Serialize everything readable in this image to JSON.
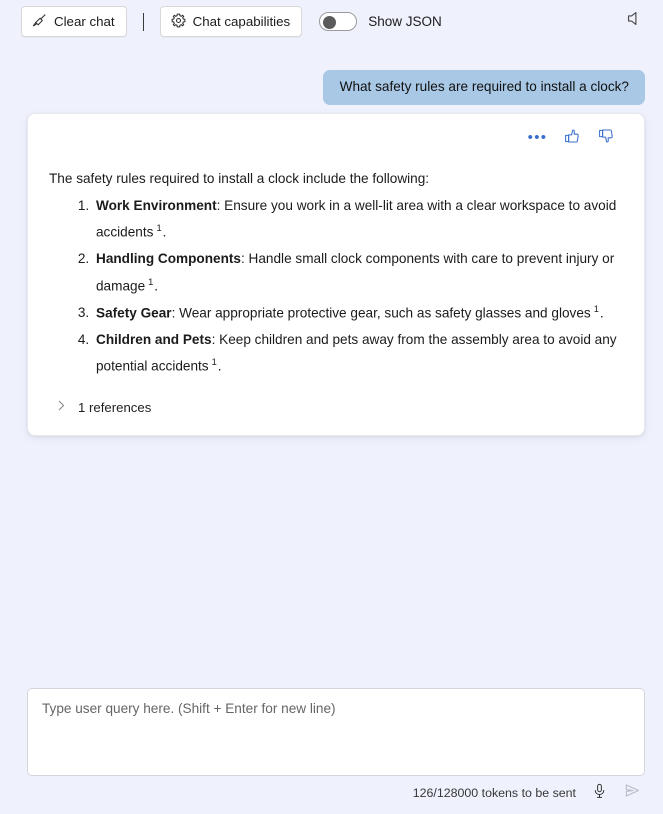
{
  "toolbar": {
    "clear_chat_label": "Clear chat",
    "clear_chat_icon": "broom-icon",
    "chat_capabilities_label": "Chat capabilities",
    "chat_capabilities_icon": "gear-icon",
    "show_json_label": "Show JSON",
    "show_json_state": "off",
    "speaker_icon": "speaker-icon"
  },
  "conversation": {
    "user_message": "What safety rules are required to install a clock?",
    "assistant": {
      "actions": {
        "more_icon": "ellipsis-icon",
        "thumbs_up_icon": "thumbs-up-icon",
        "thumbs_down_icon": "thumbs-down-icon"
      },
      "intro": "The safety rules required to install a clock include the following:",
      "items": [
        {
          "term": "Work Environment",
          "text": ": Ensure you work in a well-lit area with a clear workspace to avoid accidents",
          "citation": "1",
          "tail": "."
        },
        {
          "term": "Handling Components",
          "text": ": Handle small clock components with care to prevent injury or damage",
          "citation": "1",
          "tail": "."
        },
        {
          "term": "Safety Gear",
          "text": ": Wear appropriate protective gear, such as safety glasses and gloves",
          "citation": "1",
          "tail": "."
        },
        {
          "term": "Children and Pets",
          "text": ": Keep children and pets away from the assembly area to avoid any potential accidents",
          "citation": "1",
          "tail": "."
        }
      ],
      "references_label": "1 references",
      "references_icon": "chevron-right-icon",
      "references_expanded": false
    }
  },
  "composer": {
    "placeholder": "Type user query here. (Shift + Enter for new line)",
    "value": ""
  },
  "footer": {
    "token_count": "126/128000 tokens to be sent",
    "mic_icon": "microphone-icon",
    "send_icon": "send-icon"
  },
  "colors": {
    "page_background": "#eff2fd",
    "card_background": "#ffffff",
    "user_bubble": "#a8c8e6",
    "accent": "#3b6fce",
    "text": "#1b1b1b"
  }
}
